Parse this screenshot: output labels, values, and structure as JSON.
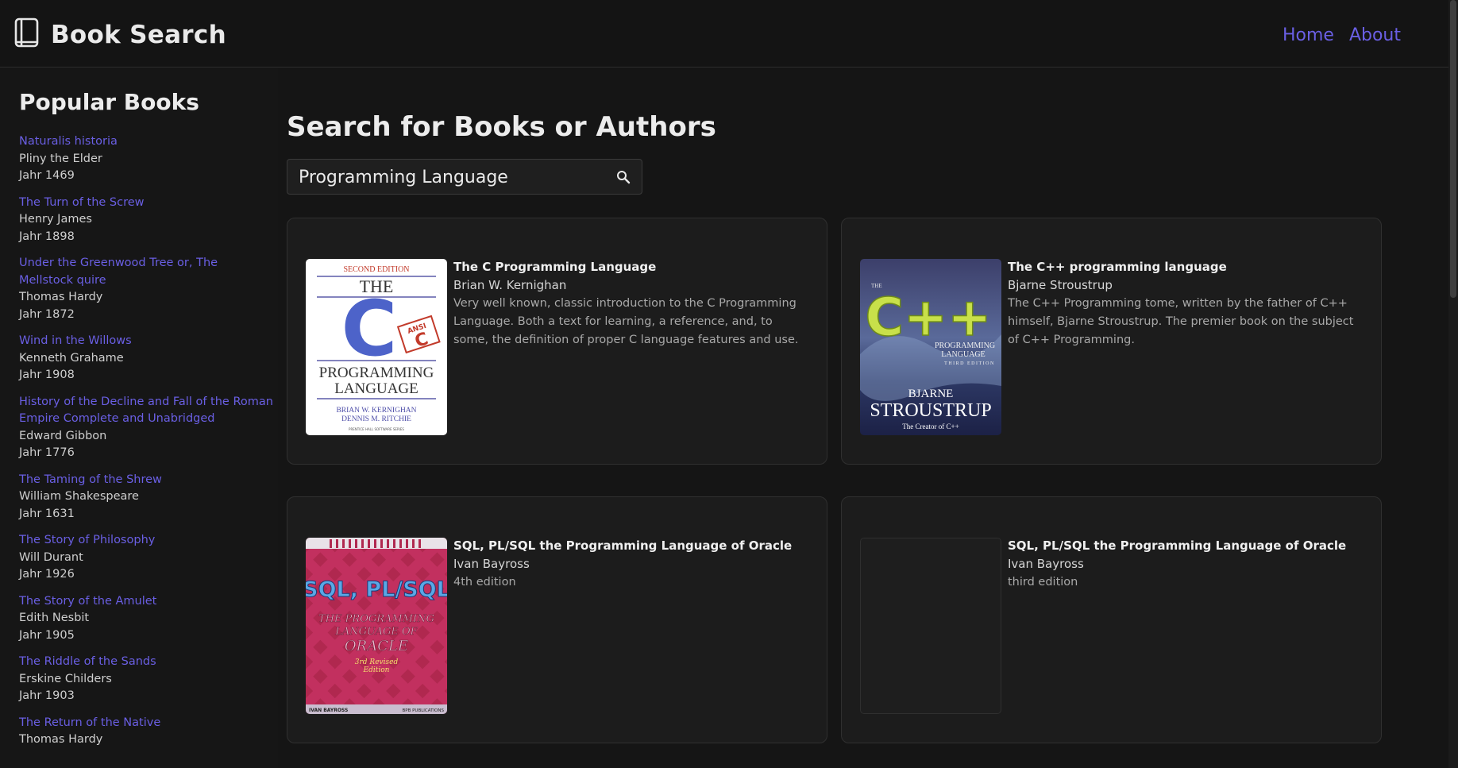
{
  "header": {
    "title": "Book Search",
    "nav": [
      {
        "label": "Home"
      },
      {
        "label": "About"
      }
    ]
  },
  "sidebar": {
    "heading": "Popular Books",
    "books": [
      {
        "title": "Naturalis historia",
        "author": "Pliny the Elder",
        "year": "Jahr 1469"
      },
      {
        "title": "The Turn of the Screw",
        "author": "Henry James",
        "year": "Jahr 1898"
      },
      {
        "title": "Under the Greenwood Tree or, The Mellstock quire",
        "author": "Thomas Hardy",
        "year": "Jahr 1872"
      },
      {
        "title": "Wind in the Willows",
        "author": "Kenneth Grahame",
        "year": "Jahr 1908"
      },
      {
        "title": "History of the Decline and Fall of the Roman Empire Complete and Unabridged",
        "author": "Edward Gibbon",
        "year": "Jahr 1776"
      },
      {
        "title": "The Taming of the Shrew",
        "author": "William Shakespeare",
        "year": "Jahr 1631"
      },
      {
        "title": "The Story of Philosophy",
        "author": "Will Durant",
        "year": "Jahr 1926"
      },
      {
        "title": "The Story of the Amulet",
        "author": "Edith Nesbit",
        "year": "Jahr 1905"
      },
      {
        "title": "The Riddle of the Sands",
        "author": "Erskine Childers",
        "year": "Jahr 1903"
      },
      {
        "title": "The Return of the Native",
        "author": "Thomas Hardy",
        "year": ""
      }
    ]
  },
  "main": {
    "heading": "Search for Books or Authors",
    "search": {
      "value": "Programming Language",
      "placeholder": ""
    },
    "results": [
      {
        "title": "The C Programming Language",
        "author": "Brian W. Kernighan",
        "description": "Very well known, classic introduction to the C Programming Language. Both a text for learning, a reference, and, to some, the definition of proper C language features and use.",
        "cover": {
          "edition": "SECOND EDITION",
          "the": "THE",
          "letter": "C",
          "badge_top": "ANSI",
          "badge_letter": "C",
          "line1": "PROGRAMMING",
          "line2": "LANGUAGE",
          "authors1": "BRIAN W. KERNIGHAN",
          "authors2": "DENNIS M. RITCHIE",
          "series": "PRENTICE HALL SOFTWARE SERIES"
        }
      },
      {
        "title": "The C++ programming language",
        "author": "Bjarne Stroustrup",
        "description": "The C++ Programming tome, written by the father of C++ himself, Bjarne Stroustrup. The premier book on the subject of C++ Programming.",
        "cover": {
          "the": "THE",
          "big": "C++",
          "line1": "PROGRAMMING",
          "line2": "LANGUAGE",
          "line3": "THIRD EDITION",
          "first": "BJARNE",
          "last": "STROUSTRUP",
          "tag": "The Creator of C++"
        }
      },
      {
        "title": "SQL, PL/SQL the Programming Language of Oracle",
        "author": "Ivan Bayross",
        "description": "4th edition",
        "cover": {
          "big": "SQL, PL/SQL",
          "sub1": "THE PROGRAMMING",
          "sub2": "LANGUAGE OF",
          "sub3": "ORACLE",
          "ed1": "3rd Revised",
          "ed2": "Edition",
          "author": "IVAN BAYROSS",
          "pub": "BPB PUBLICATIONS"
        }
      },
      {
        "title": "SQL, PL/SQL the Programming Language of Oracle",
        "author": "Ivan Bayross",
        "description": "third edition"
      }
    ]
  },
  "colors": {
    "accent": "#6a5fe4",
    "background": "#151515",
    "card": "#1c1c1c"
  }
}
